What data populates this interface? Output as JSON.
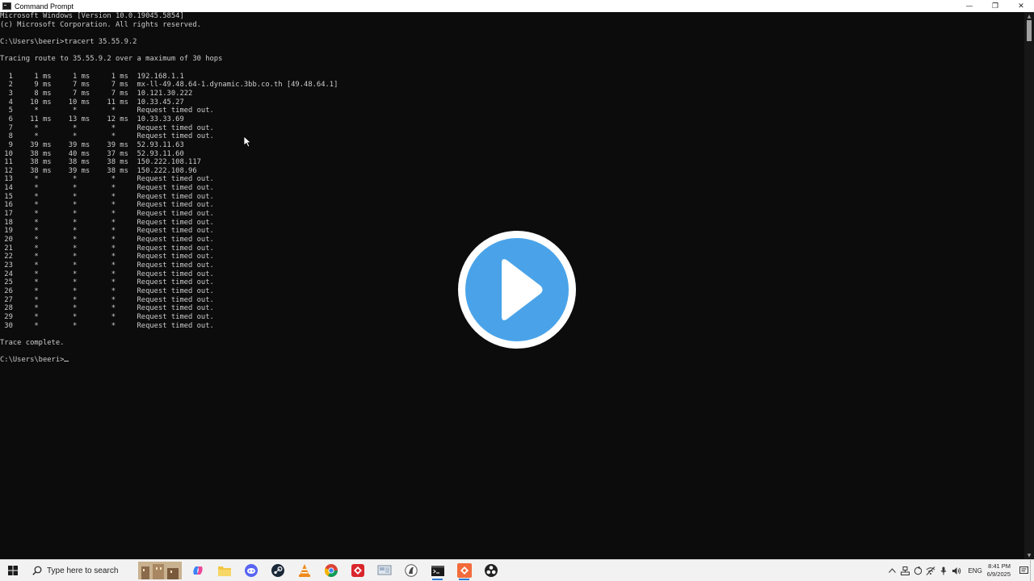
{
  "window": {
    "title": "Command Prompt",
    "minimize_glyph": "—",
    "maximize_glyph": "❐",
    "close_glyph": "✕"
  },
  "console": {
    "lines": [
      "Microsoft Windows [Version 10.0.19045.5854]",
      "(c) Microsoft Corporation. All rights reserved.",
      "",
      "C:\\Users\\beeri>tracert 35.55.9.2",
      "",
      "Tracing route to 35.55.9.2 over a maximum of 30 hops",
      "",
      "  1     1 ms     1 ms     1 ms  192.168.1.1",
      "  2     9 ms     7 ms     7 ms  mx-ll-49.48.64-1.dynamic.3bb.co.th [49.48.64.1]",
      "  3     8 ms     7 ms     7 ms  10.121.30.222",
      "  4    10 ms    10 ms    11 ms  10.33.45.27",
      "  5     *        *        *     Request timed out.",
      "  6    11 ms    13 ms    12 ms  10.33.33.69",
      "  7     *        *        *     Request timed out.",
      "  8     *        *        *     Request timed out.",
      "  9    39 ms    39 ms    39 ms  52.93.11.63",
      " 10    38 ms    40 ms    37 ms  52.93.11.60",
      " 11    38 ms    38 ms    38 ms  150.222.108.117",
      " 12    38 ms    39 ms    38 ms  150.222.108.96",
      " 13     *        *        *     Request timed out.",
      " 14     *        *        *     Request timed out.",
      " 15     *        *        *     Request timed out.",
      " 16     *        *        *     Request timed out.",
      " 17     *        *        *     Request timed out.",
      " 18     *        *        *     Request timed out.",
      " 19     *        *        *     Request timed out.",
      " 20     *        *        *     Request timed out.",
      " 21     *        *        *     Request timed out.",
      " 22     *        *        *     Request timed out.",
      " 23     *        *        *     Request timed out.",
      " 24     *        *        *     Request timed out.",
      " 25     *        *        *     Request timed out.",
      " 26     *        *        *     Request timed out.",
      " 27     *        *        *     Request timed out.",
      " 28     *        *        *     Request timed out.",
      " 29     *        *        *     Request timed out.",
      " 30     *        *        *     Request timed out.",
      "",
      "Trace complete.",
      ""
    ],
    "prompt": "C:\\Users\\beeri>",
    "text_color": "#cccccc",
    "background": "#0c0c0c"
  },
  "overlay": {
    "icon": "play-icon",
    "color": "#4aa3e8"
  },
  "taskbar": {
    "search_placeholder": "Type here to search",
    "apps": [
      {
        "name": "taskbar-app-town-thumbnail",
        "icon": "town-thumbnail-icon"
      },
      {
        "name": "taskbar-app-copilot",
        "icon": "copilot-icon"
      },
      {
        "name": "taskbar-app-file-explorer",
        "icon": "folder-icon"
      },
      {
        "name": "taskbar-app-discord",
        "icon": "discord-icon"
      },
      {
        "name": "taskbar-app-steam",
        "icon": "steam-icon"
      },
      {
        "name": "taskbar-app-vlc",
        "icon": "vlc-icon"
      },
      {
        "name": "taskbar-app-chrome",
        "icon": "chrome-icon"
      },
      {
        "name": "taskbar-app-red-app",
        "icon": "red-diamond-icon"
      },
      {
        "name": "taskbar-app-screen-tool",
        "icon": "screen-tool-icon"
      },
      {
        "name": "taskbar-app-wireshark",
        "icon": "fin-icon"
      },
      {
        "name": "taskbar-app-command-prompt",
        "icon": "terminal-icon"
      },
      {
        "name": "taskbar-app-recorder",
        "icon": "recorder-icon"
      },
      {
        "name": "taskbar-app-obs",
        "icon": "obs-icon"
      }
    ],
    "language": "ENG",
    "time": "8:41 PM",
    "date": "6/9/2025"
  }
}
